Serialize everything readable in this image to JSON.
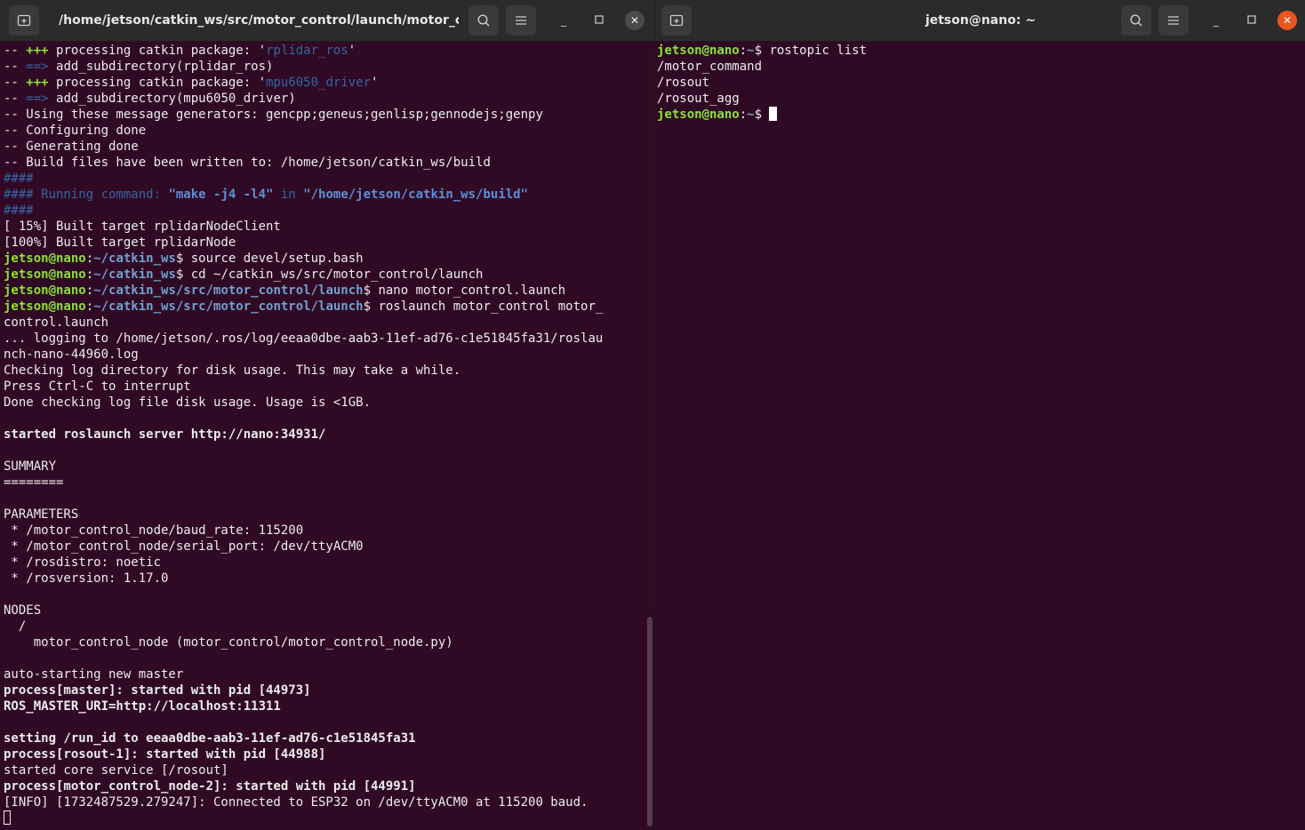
{
  "left_window": {
    "title": "/home/jetson/catkin_ws/src/motor_control/launch/motor_c...",
    "icons": {
      "new_tab": "new-tab-icon",
      "search": "search-icon",
      "menu": "hamburger-menu-icon",
      "minimize": "minimize-icon",
      "maximize": "maximize-icon",
      "close": "close-icon"
    },
    "minimize_glyph": "_",
    "close_glyph": "✕",
    "lines": [
      [
        {
          "t": "-- ",
          "c": "w"
        },
        {
          "t": "+++",
          "c": "g"
        },
        {
          "t": " processing catkin package: '",
          "c": "w"
        },
        {
          "t": "rplidar_ros",
          "c": "bl"
        },
        {
          "t": "'",
          "c": "w"
        }
      ],
      [
        {
          "t": "-- ",
          "c": "w"
        },
        {
          "t": "==>",
          "c": "bl"
        },
        {
          "t": " add_subdirectory(rplidar_ros)",
          "c": "w"
        }
      ],
      [
        {
          "t": "-- ",
          "c": "w"
        },
        {
          "t": "+++",
          "c": "g"
        },
        {
          "t": " processing catkin package: '",
          "c": "w"
        },
        {
          "t": "mpu6050_driver",
          "c": "bl"
        },
        {
          "t": "'",
          "c": "w"
        }
      ],
      [
        {
          "t": "-- ",
          "c": "w"
        },
        {
          "t": "==>",
          "c": "bl"
        },
        {
          "t": " add_subdirectory(mpu6050_driver)",
          "c": "w"
        }
      ],
      [
        {
          "t": "-- Using these message generators: gencpp;geneus;genlisp;gennodejs;genpy",
          "c": "w"
        }
      ],
      [
        {
          "t": "-- Configuring done",
          "c": "w"
        }
      ],
      [
        {
          "t": "-- Generating done",
          "c": "w"
        }
      ],
      [
        {
          "t": "-- Build files have been written to: /home/jetson/catkin_ws/build",
          "c": "w"
        }
      ],
      [
        {
          "t": "####",
          "c": "bl"
        }
      ],
      [
        {
          "t": "#### Running command: ",
          "c": "bl"
        },
        {
          "t": "\"make -j4 -l4\"",
          "c": "bb"
        },
        {
          "t": " in ",
          "c": "bl"
        },
        {
          "t": "\"/home/jetson/catkin_ws/build\"",
          "c": "bb"
        }
      ],
      [
        {
          "t": "####",
          "c": "bl"
        }
      ],
      [
        {
          "t": "[ 15%] Built target rplidarNodeClient",
          "c": "w"
        }
      ],
      [
        {
          "t": "[100%] Built target rplidarNode",
          "c": "w"
        }
      ],
      [
        {
          "t": "jetson@nano",
          "c": "g"
        },
        {
          "t": ":",
          "c": "w"
        },
        {
          "t": "~/catkin_ws",
          "c": "b"
        },
        {
          "t": "$ source devel/setup.bash",
          "c": "w"
        }
      ],
      [
        {
          "t": "jetson@nano",
          "c": "g"
        },
        {
          "t": ":",
          "c": "w"
        },
        {
          "t": "~/catkin_ws",
          "c": "b"
        },
        {
          "t": "$ cd ~/catkin_ws/src/motor_control/launch",
          "c": "w"
        }
      ],
      [
        {
          "t": "jetson@nano",
          "c": "g"
        },
        {
          "t": ":",
          "c": "w"
        },
        {
          "t": "~/catkin_ws/src/motor_control/launch",
          "c": "b"
        },
        {
          "t": "$ nano motor_control.launch",
          "c": "w"
        }
      ],
      [
        {
          "t": "jetson@nano",
          "c": "g"
        },
        {
          "t": ":",
          "c": "w"
        },
        {
          "t": "~/catkin_ws/src/motor_control/launch",
          "c": "b"
        },
        {
          "t": "$ roslaunch motor_control motor_",
          "c": "w"
        }
      ],
      [
        {
          "t": "control.launch",
          "c": "w"
        }
      ],
      [
        {
          "t": "... logging to /home/jetson/.ros/log/eeaa0dbe-aab3-11ef-ad76-c1e51845fa31/roslau",
          "c": "w"
        }
      ],
      [
        {
          "t": "nch-nano-44960.log",
          "c": "w"
        }
      ],
      [
        {
          "t": "Checking log directory for disk usage. This may take a while.",
          "c": "w"
        }
      ],
      [
        {
          "t": "Press Ctrl-C to interrupt",
          "c": "w"
        }
      ],
      [
        {
          "t": "Done checking log file disk usage. Usage is <1GB.",
          "c": "w"
        }
      ],
      [],
      [
        {
          "t": "started roslaunch server http://nano:34931/",
          "c": "bold"
        }
      ],
      [],
      [
        {
          "t": "SUMMARY",
          "c": "w"
        }
      ],
      [
        {
          "t": "========",
          "c": "w"
        }
      ],
      [],
      [
        {
          "t": "PARAMETERS",
          "c": "w"
        }
      ],
      [
        {
          "t": " * /motor_control_node/baud_rate: 115200",
          "c": "w"
        }
      ],
      [
        {
          "t": " * /motor_control_node/serial_port: /dev/ttyACM0",
          "c": "w"
        }
      ],
      [
        {
          "t": " * /rosdistro: noetic",
          "c": "w"
        }
      ],
      [
        {
          "t": " * /rosversion: 1.17.0",
          "c": "w"
        }
      ],
      [],
      [
        {
          "t": "NODES",
          "c": "w"
        }
      ],
      [
        {
          "t": "  /",
          "c": "w"
        }
      ],
      [
        {
          "t": "    motor_control_node (motor_control/motor_control_node.py)",
          "c": "w"
        }
      ],
      [],
      [
        {
          "t": "auto-starting new master",
          "c": "w"
        }
      ],
      [
        {
          "t": "process[master]: started with pid [44973]",
          "c": "bold"
        }
      ],
      [
        {
          "t": "ROS_MASTER_URI=http://localhost:11311",
          "c": "bold"
        }
      ],
      [],
      [
        {
          "t": "setting /run_id to eeaa0dbe-aab3-11ef-ad76-c1e51845fa31",
          "c": "bold"
        }
      ],
      [
        {
          "t": "process[rosout-1]: started with pid [44988]",
          "c": "bold"
        }
      ],
      [
        {
          "t": "started core service [/rosout]",
          "c": "w"
        }
      ],
      [
        {
          "t": "process[motor_control_node-2]: started with pid [44991]",
          "c": "bold"
        }
      ],
      [
        {
          "t": "[INFO] [1732487529.279247]: Connected to ESP32 on /dev/ttyACM0 at 115200 baud.",
          "c": "w"
        }
      ],
      [
        {
          "t": "",
          "c": "cursor-outline"
        }
      ]
    ]
  },
  "right_window": {
    "title": "jetson@nano: ~",
    "icons": {
      "new_tab": "new-tab-icon",
      "search": "search-icon",
      "menu": "hamburger-menu-icon",
      "minimize": "minimize-icon",
      "maximize": "maximize-icon",
      "close": "close-icon"
    },
    "minimize_glyph": "_",
    "close_glyph": "✕",
    "lines": [
      [
        {
          "t": "jetson@nano",
          "c": "g"
        },
        {
          "t": ":",
          "c": "w"
        },
        {
          "t": "~",
          "c": "b"
        },
        {
          "t": "$ rostopic list",
          "c": "w"
        }
      ],
      [
        {
          "t": "/motor_command",
          "c": "w"
        }
      ],
      [
        {
          "t": "/rosout",
          "c": "w"
        }
      ],
      [
        {
          "t": "/rosout_agg",
          "c": "w"
        }
      ],
      [
        {
          "t": "jetson@nano",
          "c": "g"
        },
        {
          "t": ":",
          "c": "w"
        },
        {
          "t": "~",
          "c": "b"
        },
        {
          "t": "$ ",
          "c": "w"
        },
        {
          "t": "",
          "c": "cursor"
        }
      ]
    ]
  }
}
